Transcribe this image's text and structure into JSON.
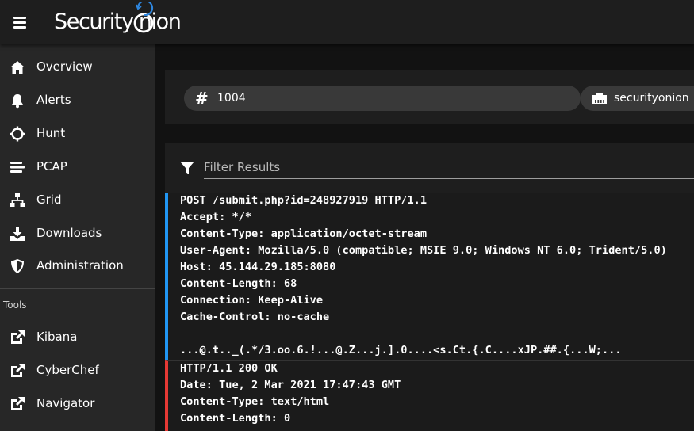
{
  "app": {
    "logo_text": "Security nion",
    "colors": {
      "accent_blue": "#2196f3",
      "accent_red": "#e53935",
      "bar": "#1e1e1e",
      "sidebar": "#272727"
    }
  },
  "sidebar": {
    "items": [
      {
        "label": "Overview",
        "icon": "home-icon"
      },
      {
        "label": "Alerts",
        "icon": "bell-icon"
      },
      {
        "label": "Hunt",
        "icon": "crosshairs-icon"
      },
      {
        "label": "PCAP",
        "icon": "stream-icon"
      },
      {
        "label": "Grid",
        "icon": "network-icon"
      },
      {
        "label": "Downloads",
        "icon": "download-icon"
      },
      {
        "label": "Administration",
        "icon": "shield-icon"
      }
    ],
    "tools_label": "Tools",
    "tools": [
      {
        "label": "Kibana",
        "icon": "external-link-icon"
      },
      {
        "label": "CyberChef",
        "icon": "external-link-icon"
      },
      {
        "label": "Navigator",
        "icon": "external-link-icon"
      }
    ]
  },
  "job": {
    "id_chip": "1004",
    "host_chip": "securityonion"
  },
  "filter": {
    "placeholder": "Filter Results",
    "value": ""
  },
  "transcript": {
    "client": [
      "POST /submit.php?id=248927919 HTTP/1.1",
      "Accept: */*",
      "Content-Type: application/octet-stream",
      "User-Agent: Mozilla/5.0 (compatible; MSIE 9.0; Windows NT 6.0; Trident/5.0)",
      "Host: 45.144.29.185:8080",
      "Content-Length: 68",
      "Connection: Keep-Alive",
      "Cache-Control: no-cache",
      "",
      "...@.t.._(.*/3.oo.6.!...@.Z...j.].0....<s.Ct.{.C....xJP.##.{...W;..."
    ],
    "server": [
      "HTTP/1.1 200 OK",
      "Date: Tue, 2 Mar 2021 17:47:43 GMT",
      "Content-Type: text/html",
      "Content-Length: 0"
    ]
  }
}
